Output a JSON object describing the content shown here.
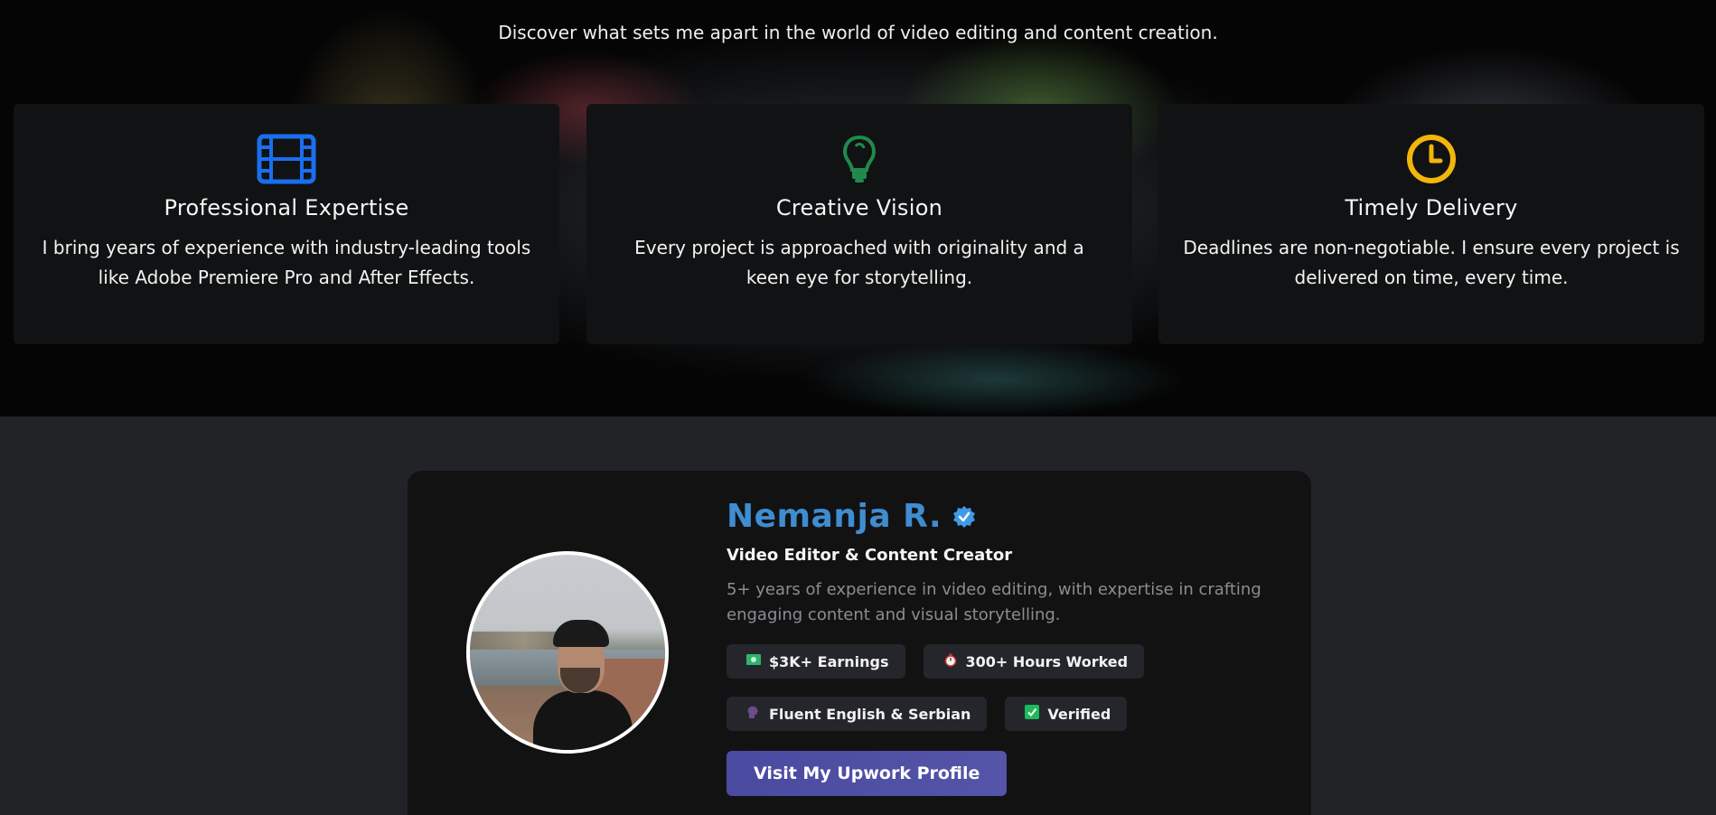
{
  "hero": {
    "subtitle": "Discover what sets me apart in the world of video editing and content creation."
  },
  "features": [
    {
      "icon": "film-icon",
      "color": "#1a6ef0",
      "title": "Professional Expertise",
      "text": "I bring years of experience with industry-leading tools like Adobe Premiere Pro and After Effects."
    },
    {
      "icon": "lightbulb-icon",
      "color": "#1f8a4c",
      "title": "Creative Vision",
      "text": "Every project is approached with originality and a keen eye for storytelling."
    },
    {
      "icon": "clock-icon",
      "color": "#f2b50a",
      "title": "Timely Delivery",
      "text": "Deadlines are non-negotiable. I ensure every project is delivered on time, every time."
    }
  ],
  "profile": {
    "name": "Nemanja R.",
    "role": "Video Editor & Content Creator",
    "description": "5+ years of experience in video editing, with expertise in crafting engaging content and visual storytelling.",
    "tags": [
      {
        "icon": "money-icon",
        "label": "$3K+ Earnings"
      },
      {
        "icon": "stopwatch-icon",
        "label": "300+ Hours Worked"
      },
      {
        "icon": "speaking-head-icon",
        "label": "Fluent English & Serbian"
      },
      {
        "icon": "checkmark-icon",
        "label": "Verified"
      }
    ],
    "cta_label": "Visit My Upwork Profile",
    "accent": "#3f8dd0"
  }
}
